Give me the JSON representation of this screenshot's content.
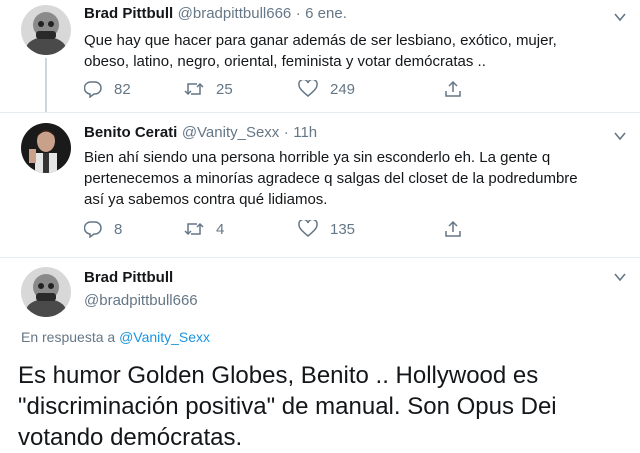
{
  "tweet1": {
    "name": "Brad Pittbull",
    "handle": "@bradpittbull666",
    "dot": "·",
    "time": "6 ene.",
    "text_line1": "Que hay que hacer para ganar además de ser lesbiano, exótico, mujer,",
    "text_line2": "obeso, latino, negro, oriental, feminista y votar demócratas ..",
    "replies": "82",
    "retweets": "25",
    "likes": "249"
  },
  "tweet2": {
    "name": "Benito Cerati",
    "handle": "@Vanity_Sexx",
    "dot": "·",
    "time": "11h",
    "text_line1": "Bien ahí siendo una persona horrible ya sin esconderlo eh. La gente q",
    "text_line2": "pertenecemos a minorías agradece q salgas del closet de la podredumbre",
    "text_line3": "así ya sabemos contra qué lidiamos.",
    "replies": "8",
    "retweets": "4",
    "likes": "135"
  },
  "tweet3": {
    "name": "Brad Pittbull",
    "handle": "@bradpittbull666",
    "reply_prefix": "En respuesta a",
    "reply_handle": "@Vanity_Sexx",
    "text_line1": "Es humor Golden Globes, Benito .. Hollywood es",
    "text_line2": "\"discriminación positiva\" de manual. Son Opus Dei",
    "text_line3": "votando demócratas."
  },
  "colors": {
    "text": "#14171a",
    "muted": "#657786",
    "link": "#1b95e0",
    "border": "#e6ecf0",
    "thread": "#ccd6dd"
  },
  "icons": [
    "reply-icon",
    "retweet-icon",
    "like-icon",
    "share-icon",
    "caret-down-icon"
  ]
}
